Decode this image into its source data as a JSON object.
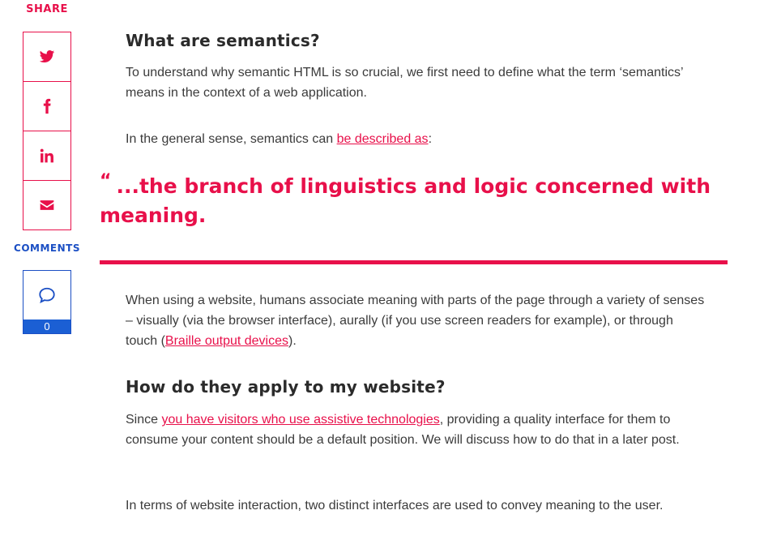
{
  "sidebar": {
    "share_label": "SHARE",
    "share_buttons": [
      {
        "icon": "twitter-icon"
      },
      {
        "icon": "facebook-icon"
      },
      {
        "icon": "linkedin-icon"
      },
      {
        "icon": "email-icon"
      }
    ],
    "comments_label": "COMMENTS",
    "comment_count": "0"
  },
  "article": {
    "heading1": "What are semantics?",
    "p1": "To understand why semantic HTML is so crucial, we first need to define what the term ‘semantics’ means in the context of a web application.",
    "p2_before": "In the general sense, semantics can ",
    "p2_link": "be described as",
    "p2_after": ":",
    "quote_mark": "“",
    "quote": "...the branch of linguistics and logic concerned with meaning.",
    "p3_before": "When using a website, humans associate meaning with parts of the page through a variety of senses – visually (via the browser interface), aurally (if you use screen readers for example), or through touch (",
    "p3_link": "Braille output devices",
    "p3_after": ").",
    "heading2": "How do they apply to my website?",
    "p4_before": "Since ",
    "p4_link": "you have visitors who use assistive technologies",
    "p4_after": ", providing a quality interface for them to consume your content should be a default position. We will discuss how to do that in a later post.",
    "p5": "In terms of website interaction, two distinct interfaces are used to convey meaning to the user."
  },
  "colors": {
    "accent": "#e8104a",
    "comments": "#1b4fc4"
  }
}
